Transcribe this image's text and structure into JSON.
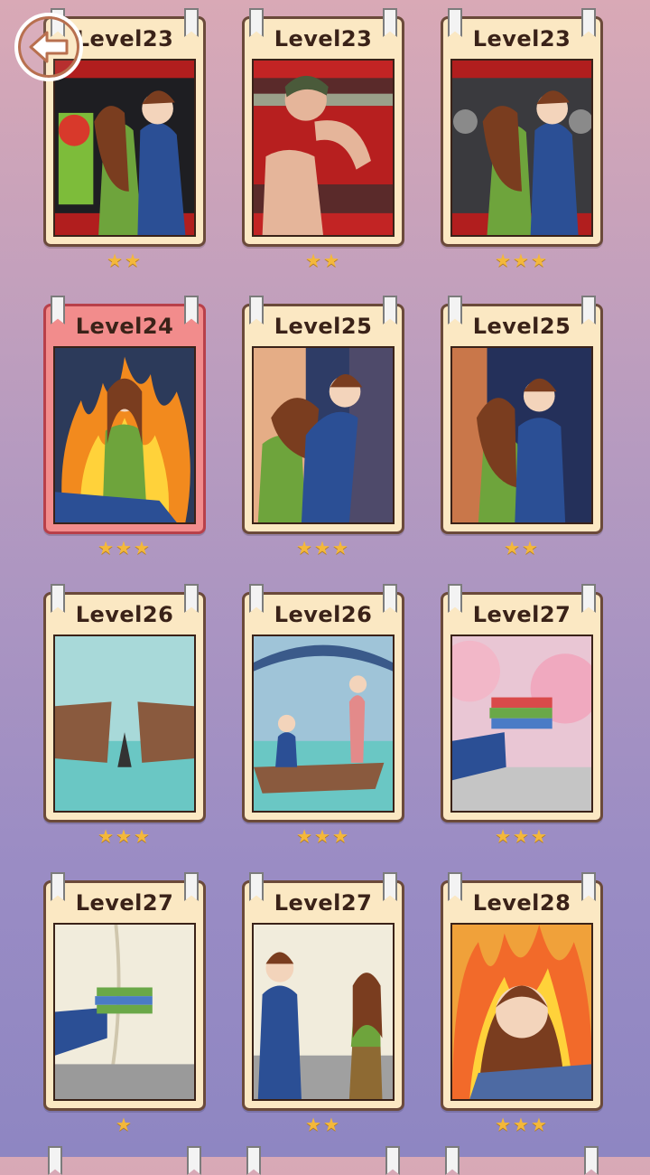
{
  "back_button": {
    "icon": "left-arrow-icon"
  },
  "colors": {
    "star": "#f4b83a",
    "card_bg": "#fbe8c3",
    "card_current_bg": "#f28c8c"
  },
  "cards": [
    {
      "label": "Level23",
      "stars": "★★",
      "current": false,
      "scene": "train-couple"
    },
    {
      "label": "Level23",
      "stars": "★★",
      "current": false,
      "scene": "shirtless-man"
    },
    {
      "label": "Level23",
      "stars": "★★★",
      "current": false,
      "scene": "train-couple-crowd"
    },
    {
      "label": "Level24",
      "stars": "★★★",
      "current": true,
      "scene": "angry-girl-fire"
    },
    {
      "label": "Level25",
      "stars": "★★★",
      "current": false,
      "scene": "couple-station"
    },
    {
      "label": "Level25",
      "stars": "★★",
      "current": false,
      "scene": "couple-smiling"
    },
    {
      "label": "Level26",
      "stars": "★★★",
      "current": false,
      "scene": "broken-boat"
    },
    {
      "label": "Level26",
      "stars": "★★★",
      "current": false,
      "scene": "boat-couple"
    },
    {
      "label": "Level27",
      "stars": "★★★",
      "current": false,
      "scene": "books-cherry-blossom"
    },
    {
      "label": "Level27",
      "stars": "★",
      "current": false,
      "scene": "books-curtain"
    },
    {
      "label": "Level27",
      "stars": "★★",
      "current": false,
      "scene": "couple-curtain"
    },
    {
      "label": "Level28",
      "stars": "★★★",
      "current": false,
      "scene": "angry-girl-fire-closeup"
    }
  ]
}
